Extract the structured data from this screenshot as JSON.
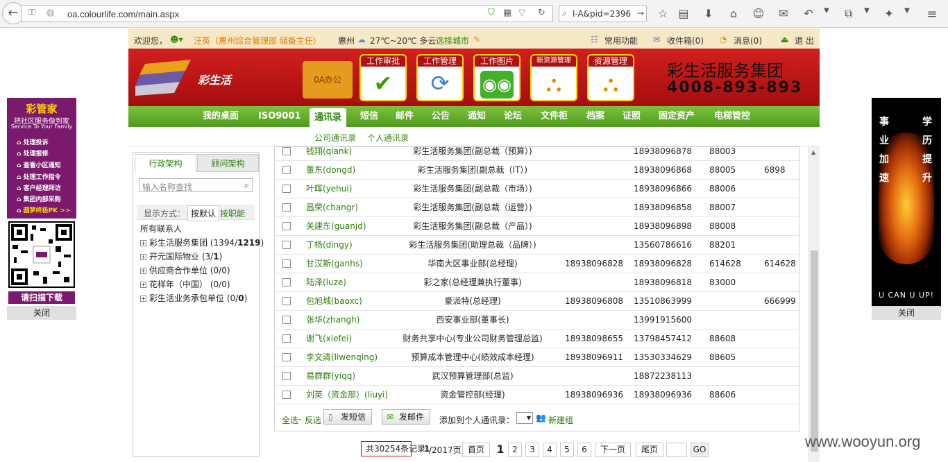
{
  "browser": {
    "url": "oa.colourlife.com/main.aspx",
    "search": "l-A&pid=2396"
  },
  "left_ad": {
    "title": "彩管家",
    "subtitle": "把社区服务做到家",
    "subtitle_en": "Service To Your Family",
    "items": [
      "处理投诉",
      "处理报修",
      "查看小区通知",
      "处理工作指令",
      "客户经理拜访",
      "集团内部采购"
    ],
    "last_item": "圆梦终极PK >>",
    "download": "请扫描下载",
    "close": "关闭"
  },
  "right_ad": {
    "chars_left": [
      "事",
      "业",
      "加",
      "速"
    ],
    "chars_right": [
      "学",
      "历",
      "提",
      "升"
    ],
    "bottom": "U CAN  U UP!",
    "close": "关闭"
  },
  "oa": {
    "welcome": "欢迎您，",
    "user": "汪英（惠州综合管理部 储备主任）",
    "city": "惠州",
    "weather": "27℃~20℃  多云",
    "choose_city": "选择城市",
    "common": "常用功能",
    "inbox": "收件箱(0)",
    "messages": "消息(0)",
    "logout": "退 出",
    "logo_text": "彩生活",
    "folder": "0A办公",
    "tiles": [
      "工作审批",
      "工作管理",
      "工作图片",
      "新资源管理",
      "资源管理"
    ],
    "brand_name": "彩生活服务集团",
    "brand_phone": "4008-893-893",
    "nav": [
      "我的桌面",
      "ISO9001",
      "通讯录",
      "短信",
      "邮件",
      "公告",
      "通知",
      "论坛",
      "文件柜",
      "档案",
      "证照",
      "固定资产",
      "电梯管控"
    ],
    "subnav": [
      "公司通讯录",
      "个人通讯录"
    ]
  },
  "left_panel": {
    "tabs": [
      "行政架构",
      "顾问架构"
    ],
    "search_placeholder": "输入名称查找",
    "mode_label": "显示方式：",
    "mode_default": "按默认",
    "mode_job": "按职能",
    "all": "所有联系人",
    "tree": [
      {
        "name": "彩生活服务集团",
        "count": "(1394/",
        "bold": "1219",
        "end": ")"
      },
      {
        "name": "开元国际物业",
        "count": "(3/",
        "bold": "1",
        "end": ")"
      },
      {
        "name": "供应商合作单位",
        "count": "(0/0)",
        "bold": "",
        "end": ""
      },
      {
        "name": "花样年（中国）",
        "count": "(0/0)",
        "bold": "",
        "end": ""
      },
      {
        "name": "彩生活业务承包单位",
        "count": "(0/",
        "bold": "0",
        "end": ")"
      }
    ]
  },
  "table": {
    "rows": [
      {
        "name": "钱翔(qiank)",
        "title": "彩生活服务集团(副总裁（预算）)",
        "tel": "",
        "mobile": "18938096878",
        "ext": "88003",
        "other": ""
      },
      {
        "name": "董东(dongd)",
        "title": "彩生活服务集团(副总裁（IT）)",
        "tel": "",
        "mobile": "18938096868",
        "ext": "88005",
        "other": "6898"
      },
      {
        "name": "叶晖(yehui)",
        "title": "彩生活服务集团(副总裁（市场）)",
        "tel": "",
        "mobile": "18938096866",
        "ext": "88006",
        "other": ""
      },
      {
        "name": "昌荣(changr)",
        "title": "彩生活服务集团(副总裁（运营）)",
        "tel": "",
        "mobile": "18938096858",
        "ext": "88007",
        "other": ""
      },
      {
        "name": "关建东(guanjd)",
        "title": "彩生活服务集团(副总裁（产品）)",
        "tel": "",
        "mobile": "18938096898",
        "ext": "88008",
        "other": ""
      },
      {
        "name": "丁杨(dingy)",
        "title": "彩生活服务集团(助理总裁（品牌）)",
        "tel": "",
        "mobile": "13560786616",
        "ext": "88201",
        "other": ""
      },
      {
        "name": "甘汉斯(ganhs)",
        "title": "华南大区事业部(总经理)",
        "tel": "18938096828",
        "mobile": "18938096828",
        "ext": "614628",
        "other": "614628"
      },
      {
        "name": "陆泽(luze)",
        "title": "彩之家(总经理兼执行董事)",
        "tel": "",
        "mobile": "18938096818",
        "ext": "83000",
        "other": ""
      },
      {
        "name": "包旭城(baoxc)",
        "title": "豪派特(总经理)",
        "tel": "18938096808",
        "mobile": "13510863999",
        "ext": "",
        "other": "666999"
      },
      {
        "name": "张华(zhangh)",
        "title": "西安事业部(董事长)",
        "tel": "",
        "mobile": "13991915600",
        "ext": "",
        "other": ""
      },
      {
        "name": "谢飞(xiefei)",
        "title": "财务共享中心(专业公司财务管理总监)",
        "tel": "18938098655",
        "mobile": "13798457412",
        "ext": "88608",
        "other": ""
      },
      {
        "name": "李文清(liwenqing)",
        "title": "预算成本管理中心(绩效成本经理)",
        "tel": "18938096911",
        "mobile": "13530334629",
        "ext": "88605",
        "other": ""
      },
      {
        "name": "易群群(yiqq)",
        "title": "武汉预算管理部(总监)",
        "tel": "",
        "mobile": "18872238113",
        "ext": "",
        "other": ""
      },
      {
        "name": "刘英（资金部）(liuyi)",
        "title": "资金管控部(经理)",
        "tel": "18938096936",
        "mobile": "18938096936",
        "ext": "88606",
        "other": ""
      }
    ],
    "select_all": "全选",
    "invert": "反选",
    "send_sms": "发短信",
    "send_mail": "发邮件",
    "add_to": "添加到个人通讯录：",
    "new_group": "新建组"
  },
  "pager": {
    "total": "共30254条记录",
    "page_prefix": "1",
    "page_suffix": "/2017页",
    "first": "首页",
    "pages": [
      "1",
      "2",
      "3",
      "4",
      "5",
      "6"
    ],
    "next": "下一页",
    "last": "尾页",
    "go": "GO"
  },
  "watermark": "www.wooyun.org"
}
